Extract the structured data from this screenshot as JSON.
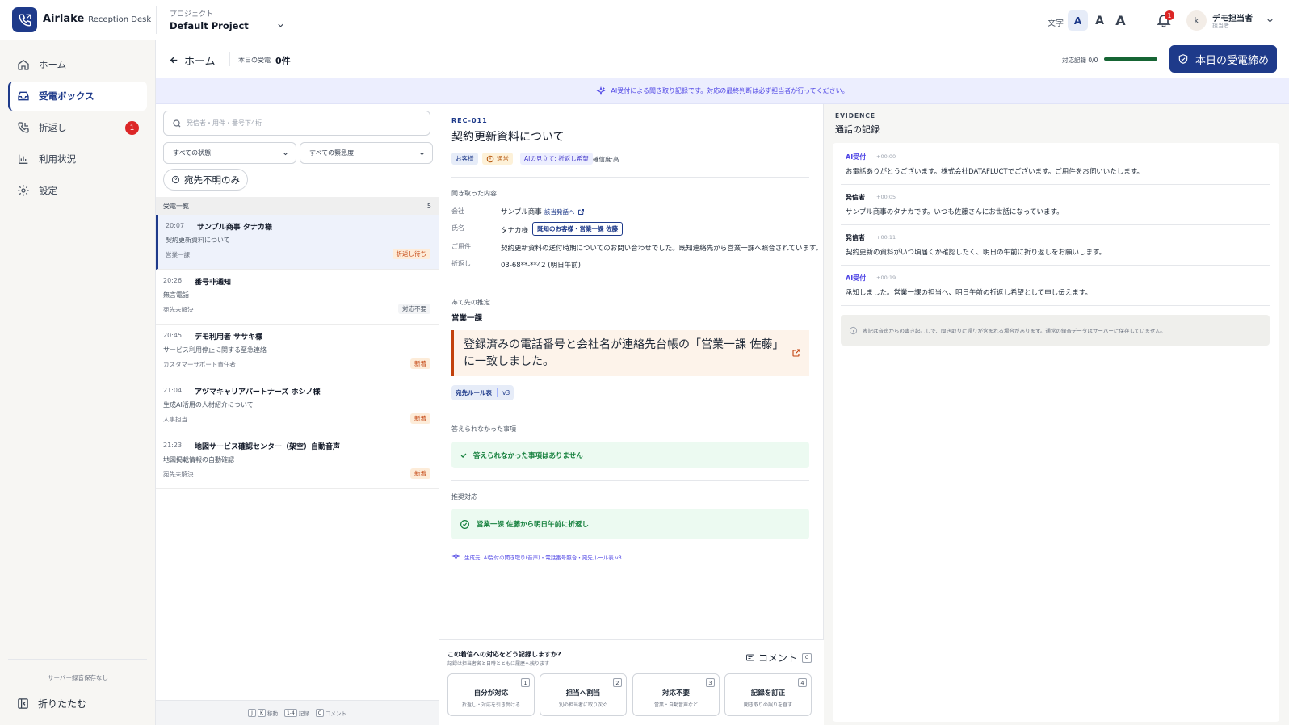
{
  "app": {
    "name": "Airlake",
    "subtitle": "Reception Desk"
  },
  "project": {
    "label": "プロジェクト",
    "value": "Default Project"
  },
  "font_size": {
    "label": "文字",
    "options": [
      "A",
      "A",
      "A"
    ],
    "selected": 0
  },
  "notifications": {
    "count": "1"
  },
  "user": {
    "initial": "k",
    "name": "デモ担当者",
    "role": "担当者"
  },
  "sidebar": {
    "items": [
      {
        "label": "ホーム",
        "icon": "home-icon"
      },
      {
        "label": "受電ボックス",
        "icon": "inbox-icon",
        "active": true
      },
      {
        "label": "折返し",
        "icon": "phone-callback-icon",
        "count": "1"
      },
      {
        "label": "利用状況",
        "icon": "chart-icon"
      },
      {
        "label": "設定",
        "icon": "gear-icon"
      }
    ],
    "footer_note": "サーバー録音保存なし",
    "collapse_label": "折りたたむ"
  },
  "topbar": {
    "back_label": "ホーム",
    "today_label": "本日の受電",
    "today_value": "0件",
    "progress_label": "対応記録 0/0",
    "progress_fraction": 1.0,
    "close_button": "本日の受電締め"
  },
  "ai_banner": "AI受付による聞き取り記録です。対応の最終判断は必ず担当者が行ってください。",
  "list": {
    "search_placeholder": "発信者・用件・番号下4桁",
    "status_filter": "すべての状態",
    "urgency_filter": "すべての緊急度",
    "unknown_only": "宛先不明のみ",
    "header": "受電一覧",
    "count": "5",
    "items": [
      {
        "time": "20:07",
        "name": "サンプル商事 タナカ様",
        "summary": "契約更新資料について",
        "assignee": "営業一課",
        "badge": "折返し待ち",
        "badge_color": "#c2410c",
        "badge_bg": "#fdecd9"
      },
      {
        "time": "20:26",
        "name": "番号非通知",
        "summary": "無言電話",
        "assignee": "宛先未解決",
        "badge": "対応不要",
        "badge_color": "#4b5563",
        "badge_bg": "#f3f4f6"
      },
      {
        "time": "20:45",
        "name": "デモ利用者 ササキ様",
        "summary": "サービス利用停止に関する至急連絡",
        "assignee": "カスタマーサポート責任者",
        "badge": "新着",
        "badge_color": "#c2410c",
        "badge_bg": "#fdecd9"
      },
      {
        "time": "21:04",
        "name": "アヅマキャリアパートナーズ ホシノ様",
        "summary": "生成AI活用の人材紹介について",
        "assignee": "人事担当",
        "badge": "新着",
        "badge_color": "#c2410c",
        "badge_bg": "#fdecd9"
      },
      {
        "time": "21:23",
        "name": "地図サービス確認センター（架空）自動音声",
        "summary": "地図掲載情報の自動確認",
        "assignee": "宛先未解決",
        "badge": "新着",
        "badge_color": "#c2410c",
        "badge_bg": "#fdecd9"
      }
    ],
    "shortcuts": [
      {
        "keys": [
          "J",
          "K"
        ],
        "label": "移動"
      },
      {
        "keys": [
          "1-4"
        ],
        "label": "記録"
      },
      {
        "keys": [
          "C"
        ],
        "label": "コメント"
      }
    ]
  },
  "detail": {
    "id": "REC-011",
    "title": "契約更新資料について",
    "tags": [
      "お客様",
      "通常",
      "AIの見立て: 折返し希望"
    ],
    "confidence": "確信度:高",
    "heard_label": "聞き取った内容",
    "fields": {
      "company_k": "会社",
      "company_v": "サンプル商事",
      "company_link": "該当発話へ",
      "name_k": "氏名",
      "name_v": "タナカ様",
      "name_tag": "既知のお客様・営業一課 佐藤",
      "purpose_k": "ご用件",
      "purpose_v": "契約更新資料の送付時期についてのお問い合わせでした。既知連絡先から営業一課へ照合されています。",
      "callback_k": "折返し",
      "callback_v": "03-68**-**42 (明日午前)"
    },
    "dest_label": "あて先の推定",
    "dest_value": "営業一課",
    "dest_reason": "登録済みの電話番号と会社名が連絡先台帳の「営業一課 佐藤」に一致しました。",
    "rule_tag": "宛先ルール表",
    "rule_version": "v3",
    "unanswered_label": "答えられなかった事項",
    "unanswered_value": "答えられなかった事項はありません",
    "recommend_label": "推奨対応",
    "recommend_value": "営業一課 佐藤から明日午前に折返し",
    "source": "生成元: AI受付の聞き取り(音声)・電話番号照合・宛先ルール表 v3"
  },
  "action": {
    "question": "この着信への対応をどう記録しますか?",
    "hint": "記録は担当者名と日時とともに履歴へ残ります",
    "comment": "コメント",
    "comment_key": "C",
    "buttons": [
      {
        "label": "自分が対応",
        "desc": "折返し・対応を引き受ける",
        "key": "1"
      },
      {
        "label": "担当へ割当",
        "desc": "別の担当者に取り次ぐ",
        "key": "2"
      },
      {
        "label": "対応不要",
        "desc": "営業・自動音声など",
        "key": "3"
      },
      {
        "label": "記録を訂正",
        "desc": "聞き取りの誤りを直す",
        "key": "4"
      }
    ]
  },
  "evidence": {
    "eyebrow": "EVIDENCE",
    "title": "通話の記録",
    "messages": [
      {
        "speaker": "AI受付",
        "ts": "+00:00",
        "text": "お電話ありがとうございます。株式会社DATAFLUCTでございます。ご用件をお伺いいたします。",
        "color": "#4f46e5"
      },
      {
        "speaker": "発信者",
        "ts": "+00:05",
        "text": "サンプル商事のタナカです。いつも佐藤さんにお世話になっています。",
        "color": "#111827"
      },
      {
        "speaker": "発信者",
        "ts": "+00:11",
        "text": "契約更新の資料がいつ頃届くか確認したく、明日の午前に折り返しをお願いします。",
        "color": "#111827"
      },
      {
        "speaker": "AI受付",
        "ts": "+00:19",
        "text": "承知しました。営業一課の担当へ、明日午前の折返し希望として申し伝えます。",
        "color": "#4f46e5"
      }
    ],
    "note": "表記は音声からの書き起こしで、聞き取りに誤りが含まれる場合があります。通常の録音データはサーバーに保存していません。"
  }
}
